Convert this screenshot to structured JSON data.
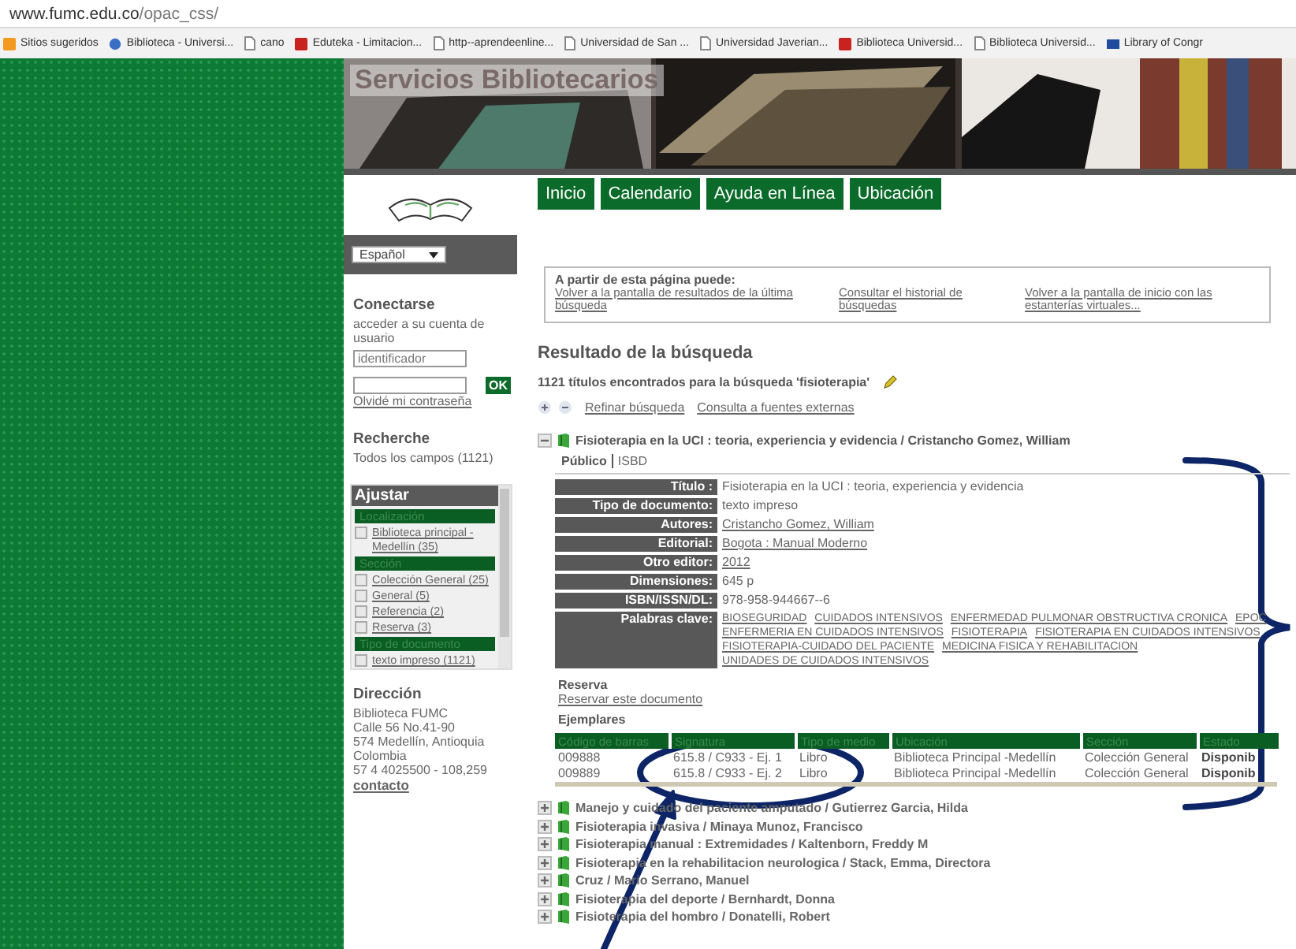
{
  "browser": {
    "url_host": "www.fumc.edu.co",
    "url_path": "/opac_css/",
    "bookmarks": [
      {
        "label": "Sitios sugeridos",
        "kind": "star"
      },
      {
        "label": "Biblioteca - Universi...",
        "kind": "globe"
      },
      {
        "label": "cano",
        "kind": "page"
      },
      {
        "label": "Eduteka - Limitacion...",
        "kind": "red"
      },
      {
        "label": "http--aprendeenline...",
        "kind": "page"
      },
      {
        "label": "Universidad de San ...",
        "kind": "page"
      },
      {
        "label": "Universidad Javerian...",
        "kind": "page"
      },
      {
        "label": "Biblioteca Universid...",
        "kind": "red"
      },
      {
        "label": "Biblioteca Universid...",
        "kind": "page"
      },
      {
        "label": "Library of Congr",
        "kind": "blue"
      }
    ]
  },
  "header": {
    "title": "Servicios Bibliotecarios",
    "nav": [
      "Inicio",
      "Calendario",
      "Ayuda en Línea",
      "Ubicación"
    ]
  },
  "sidebar": {
    "language": "Español",
    "login": {
      "heading": "Conectarse",
      "text": "acceder a su cuenta de usuario",
      "user_value": "identificador",
      "ok": "OK",
      "forgot": "Olvidé mi contraseña"
    },
    "search": {
      "heading": "Recherche",
      "text": "Todos los campos (1121)"
    },
    "facets": {
      "heading": "Ajustar",
      "groups": [
        {
          "title": "Localización",
          "items": [
            {
              "label": "Biblioteca principal - Medellín (35)",
              "checked": false
            }
          ]
        },
        {
          "title": "Sección",
          "items": [
            {
              "label": "Colección General (25)",
              "checked": false
            },
            {
              "label": "General (5)",
              "checked": false
            },
            {
              "label": "Referencia (2)",
              "checked": false
            },
            {
              "label": "Reserva (3)",
              "checked": false
            }
          ]
        },
        {
          "title": "Tipo de documento",
          "items": [
            {
              "label": "texto impreso (1121)",
              "checked": false
            }
          ]
        }
      ]
    },
    "address": {
      "heading": "Dirección",
      "lines": [
        "Biblioteca FUMC",
        "Calle 56 No.41-90",
        "574 Medellín, Antioquia",
        "Colombia",
        "57 4 4025500 - 108,259"
      ],
      "link": "contacto"
    }
  },
  "main": {
    "info_box": {
      "heading": "A partir de esta página puede:",
      "links": [
        "Volver a la pantalla de resultados de la última búsqueda",
        "Consultar el historial de búsquedas",
        "Volver a la pantalla de inicio con las estanterías virtuales..."
      ]
    },
    "result_heading": "Resultado de la búsqueda",
    "result_count": "1121 títulos encontrados para la búsqueda 'fisioterapia'",
    "refine_links": [
      "Refinar búsqueda",
      "Consulta a fuentes externas"
    ],
    "record": {
      "title": "Fisioterapia en la UCI : teoria, experiencia y evidencia / Cristancho Gomez, William",
      "expanded": true,
      "views": [
        "Público",
        "ISBD"
      ],
      "fields": [
        {
          "label": "Título :",
          "kind": "text",
          "value": "Fisioterapia en la UCI : teoria, experiencia y evidencia"
        },
        {
          "label": "Tipo de documento:",
          "kind": "text",
          "value": "texto impreso"
        },
        {
          "label": "Autores:",
          "kind": "link",
          "value": "Cristancho Gomez, William"
        },
        {
          "label": "Editorial:",
          "kind": "link",
          "value": "Bogota : Manual Moderno"
        },
        {
          "label": "Otro editor:",
          "kind": "link",
          "value": "2012"
        },
        {
          "label": "Dimensiones:",
          "kind": "text",
          "value": "645 p"
        },
        {
          "label": "ISBN/ISSN/DL:",
          "kind": "text",
          "value": "978-958-944667--6"
        },
        {
          "label": "Palabras clave:",
          "kind": "links",
          "values": [
            "BIOSEGURIDAD",
            "CUIDADOS INTENSIVOS",
            "ENFERMEDAD PULMONAR OBSTRUCTIVA CRONICA",
            "EPOC",
            "ENFERMERIA EN CUIDADOS INTENSIVOS",
            "FISIOTERAPIA",
            "FISIOTERAPIA EN CUIDADOS INTENSIVOS",
            "FISIOTERAPIA-CUIDADO DEL PACIENTE",
            "MEDICINA FISICA Y REHABILITACION",
            "UNIDADES DE CUIDADOS INTENSIVOS"
          ]
        }
      ],
      "reserve": {
        "heading": "Reserva",
        "link": "Reservar este documento"
      },
      "copies": {
        "heading": "Ejemplares",
        "columns": [
          "Código de barras",
          "Signatura",
          "Tipo de medio",
          "Ubicación",
          "Sección",
          "Estado"
        ],
        "rows": [
          [
            "009888",
            "615.8 / C933 - Ej. 1",
            "Libro",
            "Biblioteca Principal -Medellín",
            "Colección General",
            "Disponib"
          ],
          [
            "009889",
            "615.8 / C933 - Ej. 2",
            "Libro",
            "Biblioteca Principal -Medellín",
            "Colección General",
            "Disponib"
          ]
        ]
      }
    },
    "other_results": [
      {
        "title": "Manejo y cuidado del paciente amputado / Gutierrez Garcia, Hilda",
        "expanded": false
      },
      {
        "title": "Fisioterapia invasiva / Minaya Munoz, Francisco",
        "expanded": false
      },
      {
        "title": "Fisioterapia manual : Extremidades / Kaltenborn, Freddy M",
        "expanded": false
      },
      {
        "title": "Fisioterapia en la rehabilitacion neurologica / Stack, Emma, Directora",
        "expanded": false
      },
      {
        "title": "Cruz / Mario Serrano, Manuel",
        "expanded": false
      },
      {
        "title": "Fisioterapia del deporte / Bernhardt, Donna",
        "expanded": false
      },
      {
        "title": "Fisioterapia del hombro / Donatelli, Robert",
        "expanded": false
      }
    ]
  },
  "annotations": [
    {
      "kind": "ellipse"
    },
    {
      "kind": "bracket"
    },
    {
      "kind": "arrow"
    }
  ]
}
